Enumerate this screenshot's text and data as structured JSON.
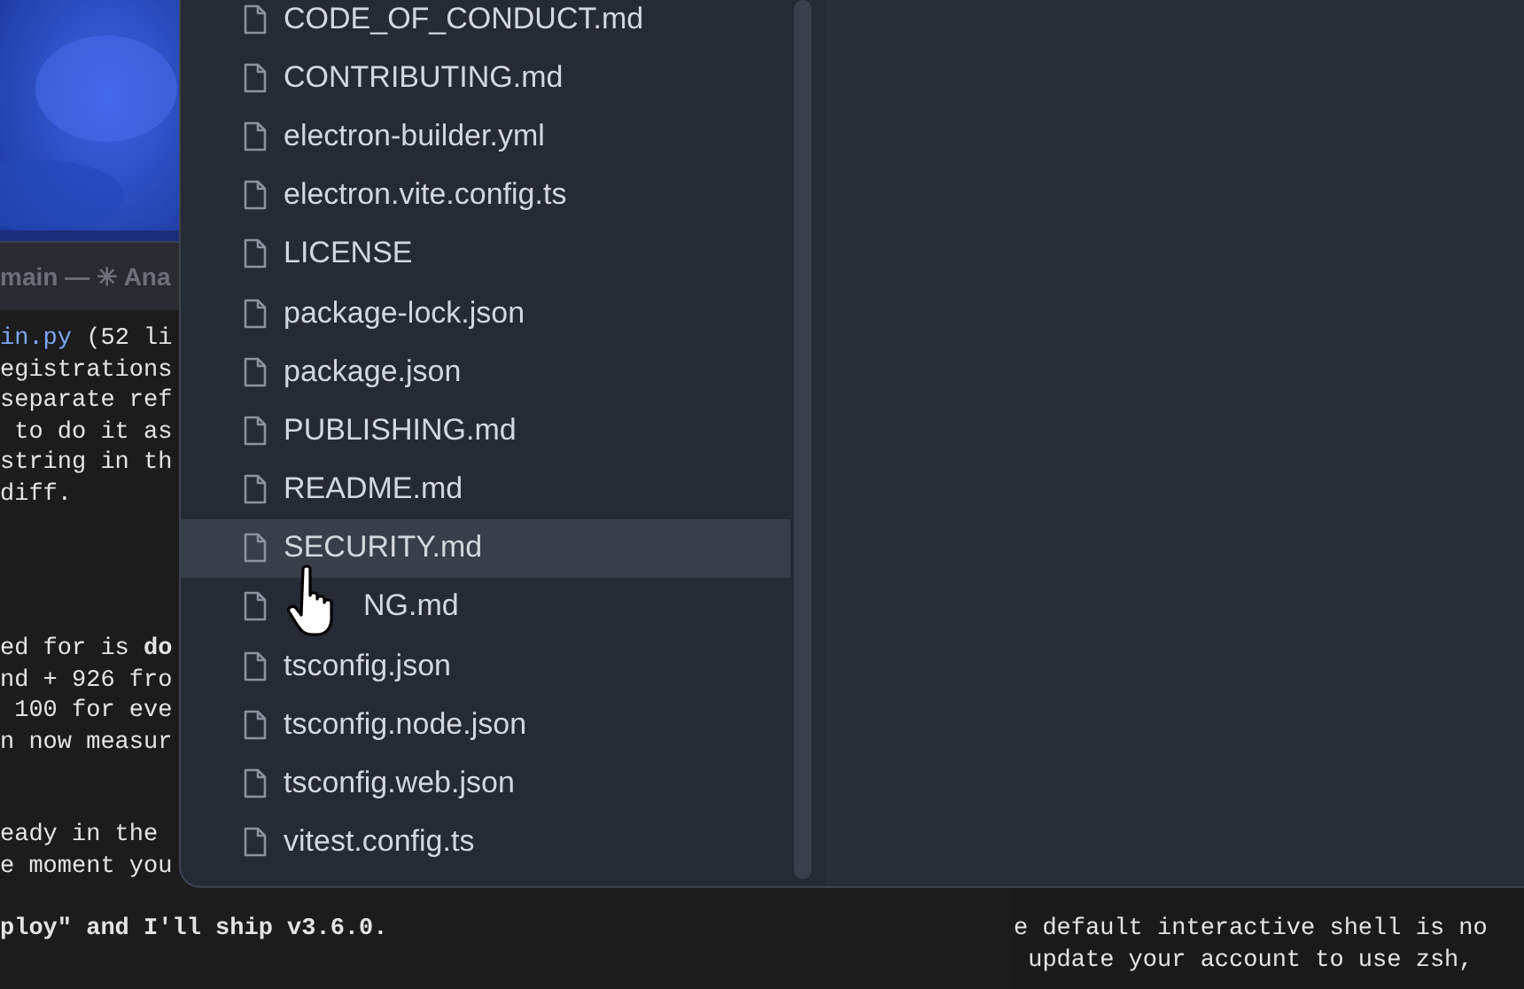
{
  "terminal": {
    "title": "main — ✳ Ana",
    "blocks": [
      [
        {
          "parts": [
            {
              "text": "in.py",
              "kind": "link"
            },
            {
              "text": " (52 li",
              "kind": "plain"
            }
          ]
        },
        {
          "parts": [
            {
              "text": "egistrations",
              "kind": "plain"
            }
          ]
        },
        {
          "parts": [
            {
              "text": "separate ref",
              "kind": "plain"
            }
          ]
        },
        {
          "parts": [
            {
              "text": " to do it as",
              "kind": "plain"
            }
          ]
        },
        {
          "parts": [
            {
              "text": "string in th",
              "kind": "plain"
            }
          ]
        },
        {
          "parts": [
            {
              "text": "diff.",
              "kind": "plain"
            }
          ]
        }
      ],
      [
        {
          "parts": [
            {
              "text": "ed for is ",
              "kind": "plain"
            },
            {
              "text": "do",
              "kind": "bold"
            }
          ]
        },
        {
          "parts": [
            {
              "text": "nd + 926 fro",
              "kind": "plain"
            }
          ]
        },
        {
          "parts": [
            {
              "text": " 100 for eve",
              "kind": "plain"
            }
          ]
        },
        {
          "parts": [
            {
              "text": "n now measur",
              "kind": "plain"
            }
          ]
        }
      ],
      [
        {
          "parts": [
            {
              "text": "eady in the",
              "kind": "plain"
            }
          ]
        },
        {
          "parts": [
            {
              "text": "e moment you",
              "kind": "plain"
            }
          ]
        }
      ],
      [
        {
          "parts": [
            {
              "text": "ploy\" and I'll ship v3.6.0.",
              "kind": "bold"
            }
          ]
        }
      ]
    ]
  },
  "file_picker": {
    "files": [
      {
        "name": "CODE_OF_CONDUCT.md",
        "selected": false
      },
      {
        "name": "CONTRIBUTING.md",
        "selected": false
      },
      {
        "name": "electron-builder.yml",
        "selected": false
      },
      {
        "name": "electron.vite.config.ts",
        "selected": false
      },
      {
        "name": "LICENSE",
        "selected": false
      },
      {
        "name": "package-lock.json",
        "selected": false
      },
      {
        "name": "package.json",
        "selected": false
      },
      {
        "name": "PUBLISHING.md",
        "selected": false
      },
      {
        "name": "README.md",
        "selected": false
      },
      {
        "name": "SECURITY.md",
        "selected": true
      },
      {
        "name": "NG.md",
        "selected": false,
        "kind": "covered"
      },
      {
        "name": "tsconfig.json",
        "selected": false
      },
      {
        "name": "tsconfig.node.json",
        "selected": false
      },
      {
        "name": "tsconfig.web.json",
        "selected": false
      },
      {
        "name": "vitest.config.ts",
        "selected": false
      }
    ]
  },
  "shell_notice": {
    "lines": [
      "e default interactive shell is no",
      " update your account to use zsh,"
    ]
  }
}
